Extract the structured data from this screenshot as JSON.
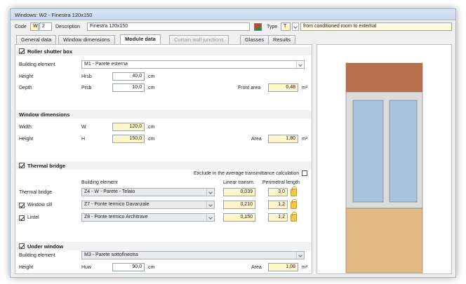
{
  "window": {
    "title": "Windows: W2 - Finestra 120x150"
  },
  "header": {
    "code_label": "Code",
    "code_prefix": "W",
    "code_number": "2",
    "description_label": "Description",
    "description_value": "Finestra 120x150",
    "type_label": "Type",
    "type_value": "T",
    "type_description": "from conditioned room to external"
  },
  "tabs": [
    {
      "label": "General data"
    },
    {
      "label": "Window dimensions"
    },
    {
      "label": "Module data"
    },
    {
      "label": "Curtain wall junctions"
    },
    {
      "label": "Glasses"
    },
    {
      "label": "Results"
    }
  ],
  "roller_shutter": {
    "title": "Roller shutter box",
    "building_element_label": "Building element",
    "building_element_value": "M1 - Parete esterna",
    "height_label": "Height",
    "height_symbol": "Hrsb",
    "height_value": "40,0",
    "height_unit": "cm",
    "depth_label": "Depth",
    "depth_symbol": "Prsb",
    "depth_value": "10,0",
    "depth_unit": "cm",
    "front_area_label": "Front area",
    "front_area_value": "0,48",
    "front_area_unit": "m²"
  },
  "window_dimensions": {
    "title": "Window dimensions",
    "width_label": "Width",
    "width_symbol": "W",
    "width_value": "120,0",
    "width_unit": "cm",
    "height_label": "Height",
    "height_symbol": "H",
    "height_value": "150,0",
    "height_unit": "cm",
    "area_label": "Area",
    "area_value": "1,80",
    "area_unit": "m²"
  },
  "thermal_bridge": {
    "title": "Thermal bridge",
    "exclude_label": "Exclude in the average transmittance calculation",
    "col_building_element": "Building element",
    "col_linear_transm": "Linear transm.",
    "col_perimetral_length": "Perimetral length",
    "rows": [
      {
        "label": "Thermal bridge",
        "element": "Z4 - W - Parete - Telaio",
        "linear": "0,039",
        "length": "3,0"
      },
      {
        "label": "Window sill",
        "element": "Z7 - Ponte termico Davanzale",
        "linear": "0,210",
        "length": "1,2"
      },
      {
        "label": "Lintel",
        "element": "Z8 - Ponte termico Architrave",
        "linear": "0,150",
        "length": "1,2"
      }
    ]
  },
  "under_window": {
    "title": "Under window",
    "building_element_label": "Building element",
    "building_element_value": "M3 - Parete sottofinestra",
    "height_label": "Height",
    "height_symbol": "Huw",
    "height_value": "90,0",
    "height_unit": "cm",
    "area_label": "Area",
    "area_value": "1,08",
    "area_unit": "m²"
  },
  "colors": {
    "shutter_box": "#b8704c",
    "frame": "#dcdcdc",
    "glass": "#a9c3df",
    "under_window": "#e2b883",
    "highlight_field": "#fff6cc"
  }
}
